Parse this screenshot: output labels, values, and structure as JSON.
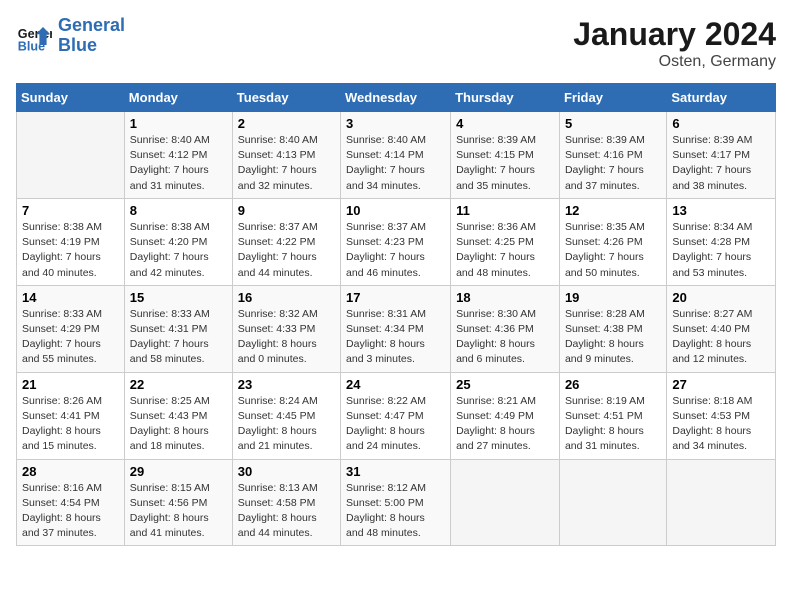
{
  "header": {
    "logo_line1": "General",
    "logo_line2": "Blue",
    "month": "January 2024",
    "location": "Osten, Germany"
  },
  "weekdays": [
    "Sunday",
    "Monday",
    "Tuesday",
    "Wednesday",
    "Thursday",
    "Friday",
    "Saturday"
  ],
  "weeks": [
    [
      {
        "day": "",
        "info": ""
      },
      {
        "day": "1",
        "info": "Sunrise: 8:40 AM\nSunset: 4:12 PM\nDaylight: 7 hours\nand 31 minutes."
      },
      {
        "day": "2",
        "info": "Sunrise: 8:40 AM\nSunset: 4:13 PM\nDaylight: 7 hours\nand 32 minutes."
      },
      {
        "day": "3",
        "info": "Sunrise: 8:40 AM\nSunset: 4:14 PM\nDaylight: 7 hours\nand 34 minutes."
      },
      {
        "day": "4",
        "info": "Sunrise: 8:39 AM\nSunset: 4:15 PM\nDaylight: 7 hours\nand 35 minutes."
      },
      {
        "day": "5",
        "info": "Sunrise: 8:39 AM\nSunset: 4:16 PM\nDaylight: 7 hours\nand 37 minutes."
      },
      {
        "day": "6",
        "info": "Sunrise: 8:39 AM\nSunset: 4:17 PM\nDaylight: 7 hours\nand 38 minutes."
      }
    ],
    [
      {
        "day": "7",
        "info": "Sunrise: 8:38 AM\nSunset: 4:19 PM\nDaylight: 7 hours\nand 40 minutes."
      },
      {
        "day": "8",
        "info": "Sunrise: 8:38 AM\nSunset: 4:20 PM\nDaylight: 7 hours\nand 42 minutes."
      },
      {
        "day": "9",
        "info": "Sunrise: 8:37 AM\nSunset: 4:22 PM\nDaylight: 7 hours\nand 44 minutes."
      },
      {
        "day": "10",
        "info": "Sunrise: 8:37 AM\nSunset: 4:23 PM\nDaylight: 7 hours\nand 46 minutes."
      },
      {
        "day": "11",
        "info": "Sunrise: 8:36 AM\nSunset: 4:25 PM\nDaylight: 7 hours\nand 48 minutes."
      },
      {
        "day": "12",
        "info": "Sunrise: 8:35 AM\nSunset: 4:26 PM\nDaylight: 7 hours\nand 50 minutes."
      },
      {
        "day": "13",
        "info": "Sunrise: 8:34 AM\nSunset: 4:28 PM\nDaylight: 7 hours\nand 53 minutes."
      }
    ],
    [
      {
        "day": "14",
        "info": "Sunrise: 8:33 AM\nSunset: 4:29 PM\nDaylight: 7 hours\nand 55 minutes."
      },
      {
        "day": "15",
        "info": "Sunrise: 8:33 AM\nSunset: 4:31 PM\nDaylight: 7 hours\nand 58 minutes."
      },
      {
        "day": "16",
        "info": "Sunrise: 8:32 AM\nSunset: 4:33 PM\nDaylight: 8 hours\nand 0 minutes."
      },
      {
        "day": "17",
        "info": "Sunrise: 8:31 AM\nSunset: 4:34 PM\nDaylight: 8 hours\nand 3 minutes."
      },
      {
        "day": "18",
        "info": "Sunrise: 8:30 AM\nSunset: 4:36 PM\nDaylight: 8 hours\nand 6 minutes."
      },
      {
        "day": "19",
        "info": "Sunrise: 8:28 AM\nSunset: 4:38 PM\nDaylight: 8 hours\nand 9 minutes."
      },
      {
        "day": "20",
        "info": "Sunrise: 8:27 AM\nSunset: 4:40 PM\nDaylight: 8 hours\nand 12 minutes."
      }
    ],
    [
      {
        "day": "21",
        "info": "Sunrise: 8:26 AM\nSunset: 4:41 PM\nDaylight: 8 hours\nand 15 minutes."
      },
      {
        "day": "22",
        "info": "Sunrise: 8:25 AM\nSunset: 4:43 PM\nDaylight: 8 hours\nand 18 minutes."
      },
      {
        "day": "23",
        "info": "Sunrise: 8:24 AM\nSunset: 4:45 PM\nDaylight: 8 hours\nand 21 minutes."
      },
      {
        "day": "24",
        "info": "Sunrise: 8:22 AM\nSunset: 4:47 PM\nDaylight: 8 hours\nand 24 minutes."
      },
      {
        "day": "25",
        "info": "Sunrise: 8:21 AM\nSunset: 4:49 PM\nDaylight: 8 hours\nand 27 minutes."
      },
      {
        "day": "26",
        "info": "Sunrise: 8:19 AM\nSunset: 4:51 PM\nDaylight: 8 hours\nand 31 minutes."
      },
      {
        "day": "27",
        "info": "Sunrise: 8:18 AM\nSunset: 4:53 PM\nDaylight: 8 hours\nand 34 minutes."
      }
    ],
    [
      {
        "day": "28",
        "info": "Sunrise: 8:16 AM\nSunset: 4:54 PM\nDaylight: 8 hours\nand 37 minutes."
      },
      {
        "day": "29",
        "info": "Sunrise: 8:15 AM\nSunset: 4:56 PM\nDaylight: 8 hours\nand 41 minutes."
      },
      {
        "day": "30",
        "info": "Sunrise: 8:13 AM\nSunset: 4:58 PM\nDaylight: 8 hours\nand 44 minutes."
      },
      {
        "day": "31",
        "info": "Sunrise: 8:12 AM\nSunset: 5:00 PM\nDaylight: 8 hours\nand 48 minutes."
      },
      {
        "day": "",
        "info": ""
      },
      {
        "day": "",
        "info": ""
      },
      {
        "day": "",
        "info": ""
      }
    ]
  ]
}
